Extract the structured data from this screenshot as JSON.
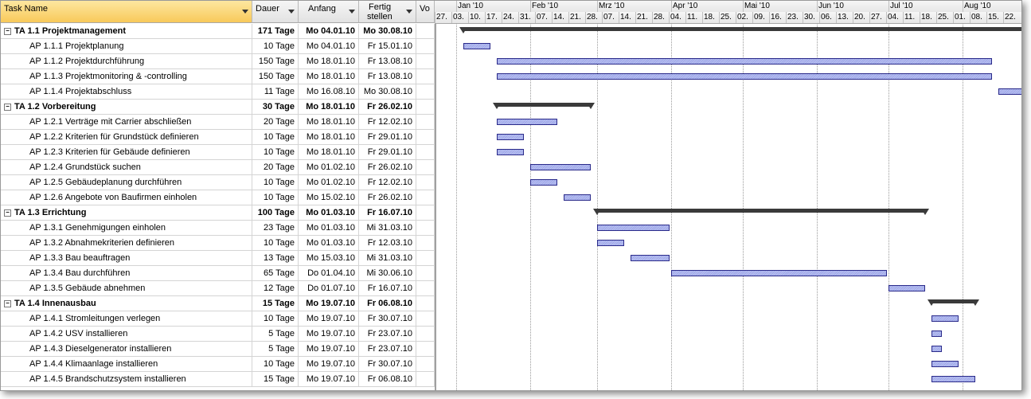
{
  "header": {
    "task_name": "Task Name",
    "duration": "Dauer",
    "start": "Anfang",
    "finish_line1": "Fertig",
    "finish_line2": "stellen",
    "vo": "Vo"
  },
  "timescale": {
    "months": [
      "Jan '10",
      "Feb '10",
      "Mrz '10",
      "Apr '10",
      "Mai '10",
      "Jun '10",
      "Jul '10",
      "Aug '10"
    ],
    "weeks": [
      "27.",
      "03.",
      "10.",
      "17.",
      "24.",
      "31.",
      "07.",
      "14.",
      "21.",
      "28.",
      "07.",
      "14.",
      "21.",
      "28.",
      "04.",
      "11.",
      "18.",
      "25.",
      "02.",
      "09.",
      "16.",
      "23.",
      "30.",
      "06.",
      "13.",
      "20.",
      "27.",
      "04.",
      "11.",
      "18.",
      "25.",
      "01.",
      "08.",
      "15.",
      "22."
    ]
  },
  "tasks": [
    {
      "name": "TA 1.1 Projektmanagement",
      "dur": "171 Tage",
      "start": "Mo 04.01.10",
      "fin": "Mo 30.08.10",
      "summary": true
    },
    {
      "name": "AP 1.1.1 Projektplanung",
      "dur": "10 Tage",
      "start": "Mo 04.01.10",
      "fin": "Fr 15.01.10"
    },
    {
      "name": "AP 1.1.2 Projektdurchführung",
      "dur": "150 Tage",
      "start": "Mo 18.01.10",
      "fin": "Fr 13.08.10"
    },
    {
      "name": "AP 1.1.3 Projektmonitoring & -controlling",
      "dur": "150 Tage",
      "start": "Mo 18.01.10",
      "fin": "Fr 13.08.10"
    },
    {
      "name": "AP 1.1.4 Projektabschluss",
      "dur": "11 Tage",
      "start": "Mo 16.08.10",
      "fin": "Mo 30.08.10"
    },
    {
      "name": "TA 1.2 Vorbereitung",
      "dur": "30 Tage",
      "start": "Mo 18.01.10",
      "fin": "Fr 26.02.10",
      "summary": true
    },
    {
      "name": "AP 1.2.1 Verträge mit Carrier abschließen",
      "dur": "20 Tage",
      "start": "Mo 18.01.10",
      "fin": "Fr 12.02.10"
    },
    {
      "name": "AP 1.2.2 Kriterien für Grundstück definieren",
      "dur": "10 Tage",
      "start": "Mo 18.01.10",
      "fin": "Fr 29.01.10"
    },
    {
      "name": "AP 1.2.3 Kriterien für Gebäude definieren",
      "dur": "10 Tage",
      "start": "Mo 18.01.10",
      "fin": "Fr 29.01.10"
    },
    {
      "name": "AP 1.2.4 Grundstück suchen",
      "dur": "20 Tage",
      "start": "Mo 01.02.10",
      "fin": "Fr 26.02.10"
    },
    {
      "name": "AP 1.2.5 Gebäudeplanung durchführen",
      "dur": "10 Tage",
      "start": "Mo 01.02.10",
      "fin": "Fr 12.02.10"
    },
    {
      "name": "AP 1.2.6 Angebote von Baufirmen einholen",
      "dur": "10 Tage",
      "start": "Mo 15.02.10",
      "fin": "Fr 26.02.10"
    },
    {
      "name": "TA 1.3 Errichtung",
      "dur": "100 Tage",
      "start": "Mo 01.03.10",
      "fin": "Fr 16.07.10",
      "summary": true
    },
    {
      "name": "AP 1.3.1 Genehmigungen einholen",
      "dur": "23 Tage",
      "start": "Mo 01.03.10",
      "fin": "Mi 31.03.10"
    },
    {
      "name": "AP 1.3.2 Abnahmekriterien definieren",
      "dur": "10 Tage",
      "start": "Mo 01.03.10",
      "fin": "Fr 12.03.10"
    },
    {
      "name": "AP 1.3.3 Bau beauftragen",
      "dur": "13 Tage",
      "start": "Mo 15.03.10",
      "fin": "Mi 31.03.10"
    },
    {
      "name": "AP 1.3.4 Bau durchführen",
      "dur": "65 Tage",
      "start": "Do 01.04.10",
      "fin": "Mi 30.06.10"
    },
    {
      "name": "AP 1.3.5 Gebäude abnehmen",
      "dur": "12 Tage",
      "start": "Do 01.07.10",
      "fin": "Fr 16.07.10"
    },
    {
      "name": "TA 1.4 Innenausbau",
      "dur": "15 Tage",
      "start": "Mo 19.07.10",
      "fin": "Fr 06.08.10",
      "summary": true
    },
    {
      "name": "AP 1.4.1 Stromleitungen verlegen",
      "dur": "10 Tage",
      "start": "Mo 19.07.10",
      "fin": "Fr 30.07.10"
    },
    {
      "name": "AP 1.4.2 USV installieren",
      "dur": "5 Tage",
      "start": "Mo 19.07.10",
      "fin": "Fr 23.07.10"
    },
    {
      "name": "AP 1.4.3 Dieselgenerator installieren",
      "dur": "5 Tage",
      "start": "Mo 19.07.10",
      "fin": "Fr 23.07.10"
    },
    {
      "name": "AP 1.4.4 Klimaanlage installieren",
      "dur": "10 Tage",
      "start": "Mo 19.07.10",
      "fin": "Fr 30.07.10"
    },
    {
      "name": "AP 1.4.5 Brandschutzsystem installieren",
      "dur": "15 Tage",
      "start": "Mo 19.07.10",
      "fin": "Fr 06.08.10"
    }
  ]
}
